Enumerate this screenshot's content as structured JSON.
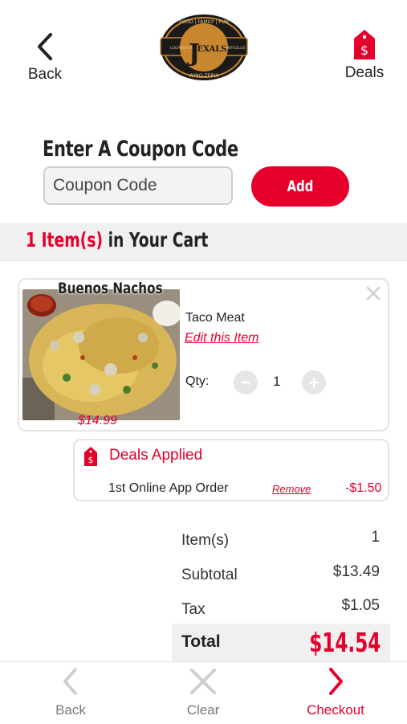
{
  "header": {
    "back_label": "Back",
    "deals_label": "Deals",
    "logo": {
      "top_arc": "FOOD | FAMILY | FUN",
      "letter": "J",
      "brand": "EXALS",
      "left_word": "LOGANSPORT",
      "right_word": "MONTICELLO",
      "bottom_arc": "WING-ZERIA"
    }
  },
  "coupon": {
    "title": "Enter A Coupon Code",
    "placeholder": "Coupon Code",
    "value": "",
    "add_label": "Add"
  },
  "cart": {
    "count_text": "1 Item(s)",
    "suffix_text": "in Your Cart"
  },
  "item": {
    "name": "Buenos Nachos",
    "price": "$14.99",
    "option": "Taco Meat",
    "edit_label": "Edit this Item",
    "qty_label": "Qty:",
    "qty": "1"
  },
  "deals_applied": {
    "title": "Deals Applied",
    "deal_name": "1st Online App Order",
    "remove_label": "Remove",
    "amount": "-$1.50"
  },
  "summary": {
    "items_label": "Item(s)",
    "items_value": "1",
    "subtotal_label": "Subtotal",
    "subtotal_value": "$13.49",
    "tax_label": "Tax",
    "tax_value": "$1.05",
    "total_label": "Total",
    "total_value": "$14.54"
  },
  "bottom_nav": {
    "back_label": "Back",
    "clear_label": "Clear",
    "checkout_label": "Checkout"
  },
  "colors": {
    "accent": "#e4002b",
    "muted": "#cfcfcf"
  },
  "icons": {
    "back": "chevron-left-icon",
    "deals": "price-tag-icon",
    "close": "close-icon",
    "minus": "minus-icon",
    "plus": "plus-icon",
    "nav_back": "chevron-left-icon",
    "nav_clear": "x-icon",
    "nav_checkout": "chevron-right-icon"
  }
}
